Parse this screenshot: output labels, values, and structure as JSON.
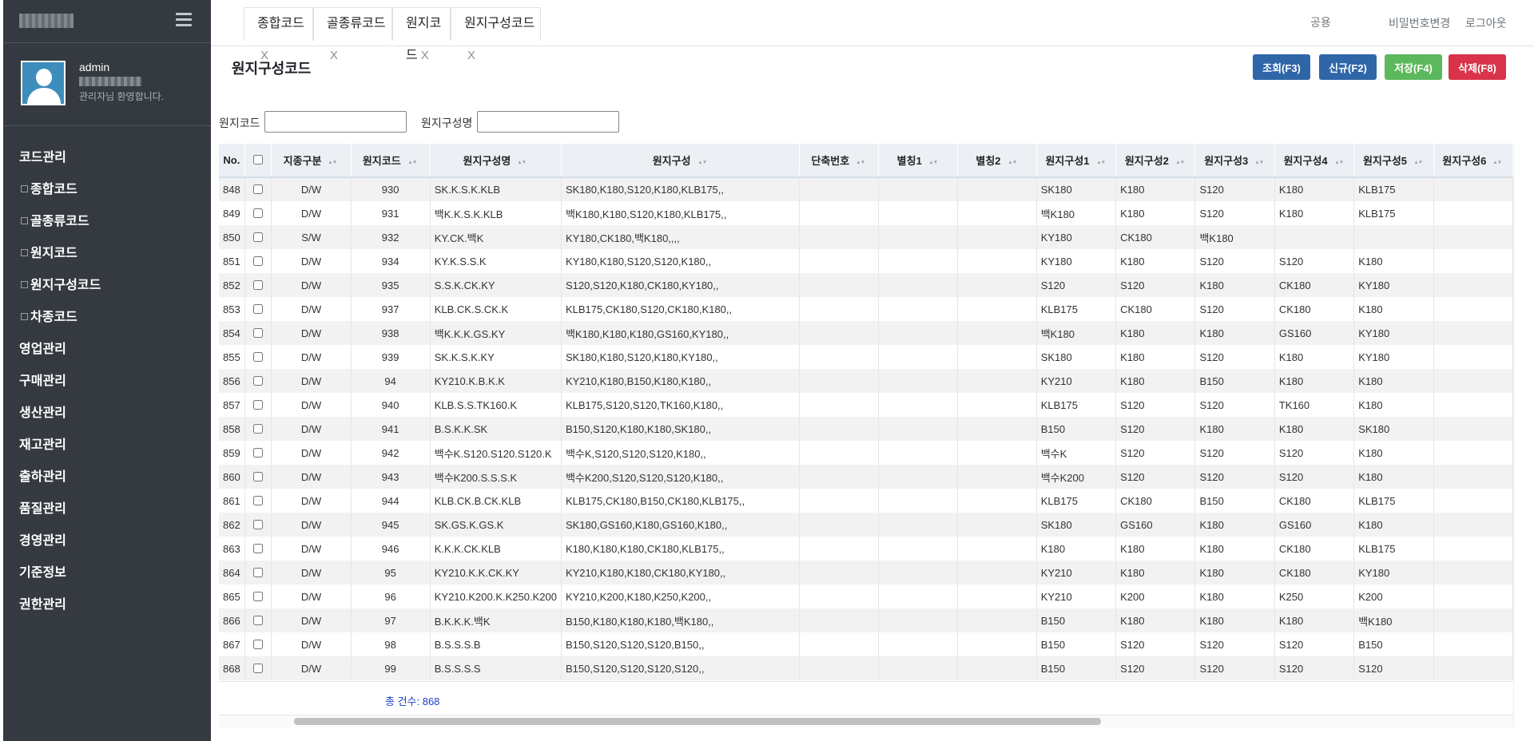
{
  "sidebar": {
    "user_name": "admin",
    "welcome": "관리자님 환영합니다.",
    "items": [
      {
        "label": "코드관리",
        "sub": false
      },
      {
        "label": "종합코드",
        "sub": true
      },
      {
        "label": "골종류코드",
        "sub": true
      },
      {
        "label": "원지코드",
        "sub": true
      },
      {
        "label": "원지구성코드",
        "sub": true
      },
      {
        "label": "차종코드",
        "sub": true
      },
      {
        "label": "영업관리",
        "sub": false
      },
      {
        "label": "구매관리",
        "sub": false
      },
      {
        "label": "생산관리",
        "sub": false
      },
      {
        "label": "재고관리",
        "sub": false
      },
      {
        "label": "출하관리",
        "sub": false
      },
      {
        "label": "품질관리",
        "sub": false
      },
      {
        "label": "경영관리",
        "sub": false
      },
      {
        "label": "기준정보",
        "sub": false
      },
      {
        "label": "권한관리",
        "sub": false
      }
    ]
  },
  "tabs": [
    {
      "label": "종합코드",
      "close": "X"
    },
    {
      "label": "골종류코드",
      "close": "X"
    },
    {
      "label": "원지코드",
      "close": "X"
    },
    {
      "label": "원지구성코드",
      "close": "X"
    }
  ],
  "topbar": {
    "search_placeholder": "공용",
    "change_password": "비밀번호변경",
    "logout": "로그아웃"
  },
  "page": {
    "title": "원지구성코드",
    "buttons": {
      "query": "조회(F3)",
      "new": "신규(F2)",
      "save": "저장(F4)",
      "delete": "삭제(F8)"
    },
    "filters": {
      "code_label": "원지코드",
      "name_label": "원지구성명"
    }
  },
  "grid": {
    "columns": [
      "No.",
      "",
      "지종구분",
      "원지코드",
      "원지구성명",
      "원지구성",
      "단축번호",
      "별칭1",
      "별칭2",
      "원지구성1",
      "원지구성2",
      "원지구성3",
      "원지구성4",
      "원지구성5",
      "원지구성6"
    ],
    "rows": [
      [
        "848",
        "D/W",
        "930",
        "SK.K.S.K.KLB",
        "SK180,K180,S120,K180,KLB175,,",
        "",
        "",
        "",
        "SK180",
        "K180",
        "S120",
        "K180",
        "KLB175",
        ""
      ],
      [
        "849",
        "D/W",
        "931",
        "백K.K.S.K.KLB",
        "백K180,K180,S120,K180,KLB175,,",
        "",
        "",
        "",
        "백K180",
        "K180",
        "S120",
        "K180",
        "KLB175",
        ""
      ],
      [
        "850",
        "S/W",
        "932",
        "KY.CK.백K",
        "KY180,CK180,백K180,,,,",
        "",
        "",
        "",
        "KY180",
        "CK180",
        "백K180",
        "",
        "",
        ""
      ],
      [
        "851",
        "D/W",
        "934",
        "KY.K.S.S.K",
        "KY180,K180,S120,S120,K180,,",
        "",
        "",
        "",
        "KY180",
        "K180",
        "S120",
        "S120",
        "K180",
        ""
      ],
      [
        "852",
        "D/W",
        "935",
        "S.S.K.CK.KY",
        "S120,S120,K180,CK180,KY180,,",
        "",
        "",
        "",
        "S120",
        "S120",
        "K180",
        "CK180",
        "KY180",
        ""
      ],
      [
        "853",
        "D/W",
        "937",
        "KLB.CK.S.CK.K",
        "KLB175,CK180,S120,CK180,K180,,",
        "",
        "",
        "",
        "KLB175",
        "CK180",
        "S120",
        "CK180",
        "K180",
        ""
      ],
      [
        "854",
        "D/W",
        "938",
        "백K.K.K.GS.KY",
        "백K180,K180,K180,GS160,KY180,,",
        "",
        "",
        "",
        "백K180",
        "K180",
        "K180",
        "GS160",
        "KY180",
        ""
      ],
      [
        "855",
        "D/W",
        "939",
        "SK.K.S.K.KY",
        "SK180,K180,S120,K180,KY180,,",
        "",
        "",
        "",
        "SK180",
        "K180",
        "S120",
        "K180",
        "KY180",
        ""
      ],
      [
        "856",
        "D/W",
        "94",
        "KY210.K.B.K.K",
        "KY210,K180,B150,K180,K180,,",
        "",
        "",
        "",
        "KY210",
        "K180",
        "B150",
        "K180",
        "K180",
        ""
      ],
      [
        "857",
        "D/W",
        "940",
        "KLB.S.S.TK160.K",
        "KLB175,S120,S120,TK160,K180,,",
        "",
        "",
        "",
        "KLB175",
        "S120",
        "S120",
        "TK160",
        "K180",
        ""
      ],
      [
        "858",
        "D/W",
        "941",
        "B.S.K.K.SK",
        "B150,S120,K180,K180,SK180,,",
        "",
        "",
        "",
        "B150",
        "S120",
        "K180",
        "K180",
        "SK180",
        ""
      ],
      [
        "859",
        "D/W",
        "942",
        "백수K.S120.S120.S120.K",
        "백수K,S120,S120,S120,K180,,",
        "",
        "",
        "",
        "백수K",
        "S120",
        "S120",
        "S120",
        "K180",
        ""
      ],
      [
        "860",
        "D/W",
        "943",
        "백수K200.S.S.S.K",
        "백수K200,S120,S120,S120,K180,,",
        "",
        "",
        "",
        "백수K200",
        "S120",
        "S120",
        "S120",
        "K180",
        ""
      ],
      [
        "861",
        "D/W",
        "944",
        "KLB.CK.B.CK.KLB",
        "KLB175,CK180,B150,CK180,KLB175,,",
        "",
        "",
        "",
        "KLB175",
        "CK180",
        "B150",
        "CK180",
        "KLB175",
        ""
      ],
      [
        "862",
        "D/W",
        "945",
        "SK.GS.K.GS.K",
        "SK180,GS160,K180,GS160,K180,,",
        "",
        "",
        "",
        "SK180",
        "GS160",
        "K180",
        "GS160",
        "K180",
        ""
      ],
      [
        "863",
        "D/W",
        "946",
        "K.K.K.CK.KLB",
        "K180,K180,K180,CK180,KLB175,,",
        "",
        "",
        "",
        "K180",
        "K180",
        "K180",
        "CK180",
        "KLB175",
        ""
      ],
      [
        "864",
        "D/W",
        "95",
        "KY210.K.K.CK.KY",
        "KY210,K180,K180,CK180,KY180,,",
        "",
        "",
        "",
        "KY210",
        "K180",
        "K180",
        "CK180",
        "KY180",
        ""
      ],
      [
        "865",
        "D/W",
        "96",
        "KY210.K200.K.K250.K200",
        "KY210,K200,K180,K250,K200,,",
        "",
        "",
        "",
        "KY210",
        "K200",
        "K180",
        "K250",
        "K200",
        ""
      ],
      [
        "866",
        "D/W",
        "97",
        "B.K.K.K.백K",
        "B150,K180,K180,K180,백K180,,",
        "",
        "",
        "",
        "B150",
        "K180",
        "K180",
        "K180",
        "백K180",
        ""
      ],
      [
        "867",
        "D/W",
        "98",
        "B.S.S.S.B",
        "B150,S120,S120,S120,B150,,",
        "",
        "",
        "",
        "B150",
        "S120",
        "S120",
        "S120",
        "B150",
        ""
      ],
      [
        "868",
        "D/W",
        "99",
        "B.S.S.S.S",
        "B150,S120,S120,S120,S120,,",
        "",
        "",
        "",
        "B150",
        "S120",
        "S120",
        "S120",
        "S120",
        ""
      ]
    ],
    "total": "총 건수: 868"
  },
  "colors": {
    "sidebar_bg": "#343a40",
    "primary_button": "#2f66a8",
    "save_button": "#5cb85c",
    "delete_button": "#d9334a",
    "total_text": "#1a3ecf"
  },
  "icons": {
    "menu": "hamburger-icon",
    "avatar": "user-avatar-icon",
    "sort": "sort-icon"
  }
}
